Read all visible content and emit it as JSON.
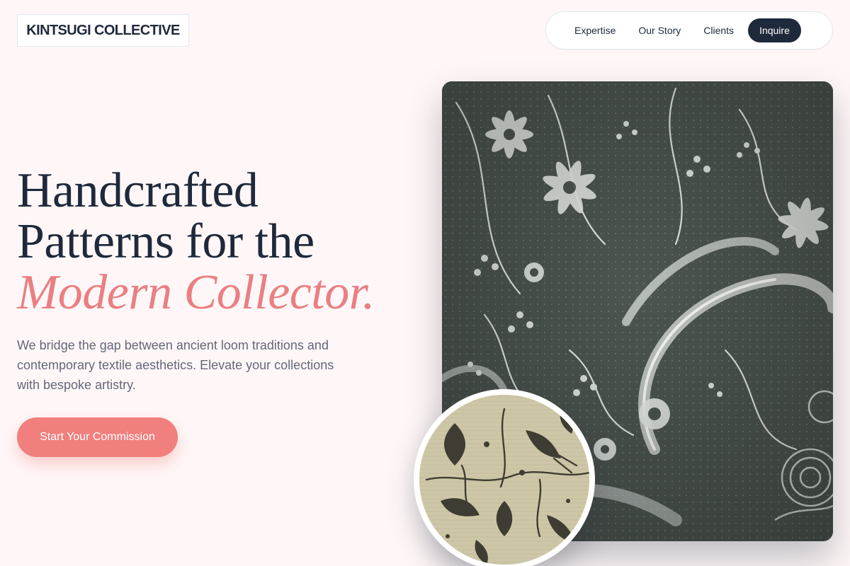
{
  "brand": {
    "name": "KINTSUGI COLLECTIVE"
  },
  "nav": {
    "items": [
      {
        "label": "Expertise"
      },
      {
        "label": "Our Story"
      },
      {
        "label": "Clients"
      },
      {
        "label": "Inquire"
      }
    ]
  },
  "hero": {
    "headline_line1": "Handcrafted",
    "headline_line2": "Patterns for the",
    "headline_accent": "Modern Collector.",
    "lead": "We bridge the gap between ancient loom traditions and contemporary textile aesthetics. Elevate your collections with bespoke artistry.",
    "cta_label": "Start Your Commission"
  },
  "colors": {
    "background": "#fff7f7",
    "ink": "#1e293b",
    "accent": "#ea7f82",
    "button": "#f07f7d",
    "muted_text": "#64687a"
  },
  "images": {
    "main": "white lace textile on dark ground",
    "inset": "ikat leaf pattern on beige cloth"
  }
}
